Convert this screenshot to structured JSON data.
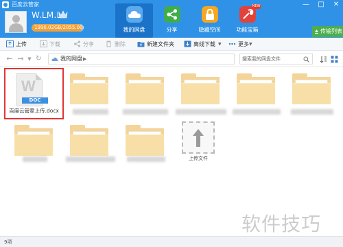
{
  "window": {
    "title": "百度云管家",
    "controls": [
      "minimize-icon",
      "maximize-icon",
      "close-icon"
    ]
  },
  "user": {
    "name": "W.LM.L",
    "quota": "1990.02GB/2055.00GB",
    "quota_fraction": 0.97,
    "vip_icon": "crown-icon"
  },
  "nav": {
    "items": [
      {
        "label": "我的网盘",
        "icon": "cloud-icon",
        "active": true
      },
      {
        "label": "分享",
        "icon": "share-icon",
        "active": false
      },
      {
        "label": "隐藏空间",
        "icon": "lock-icon",
        "active": false
      },
      {
        "label": "功能宝箱",
        "icon": "toolbox-icon",
        "active": false,
        "badge": "NEW"
      }
    ],
    "transfer_label": "传输列表"
  },
  "toolbar": {
    "upload": "上传",
    "download": "下载",
    "share": "分享",
    "delete": "删除",
    "new_folder": "新建文件夹",
    "offline_download": "离线下载",
    "more": "更多"
  },
  "addressbar": {
    "path": "我的网盘",
    "search_placeholder": "搜索我的网盘文件"
  },
  "files": {
    "doc": {
      "name": "百度云管家上传.docx",
      "badge": "DOC",
      "letter": "W"
    },
    "upload_label": "上传文件"
  },
  "watermark": "软件技巧",
  "status": {
    "count": "9项"
  },
  "colors": {
    "header": "#2f92e6",
    "active_nav": "#1a73c9",
    "folder": "#f4d498",
    "highlight_border": "#e23434",
    "transfer_button": "#4cae4c"
  }
}
